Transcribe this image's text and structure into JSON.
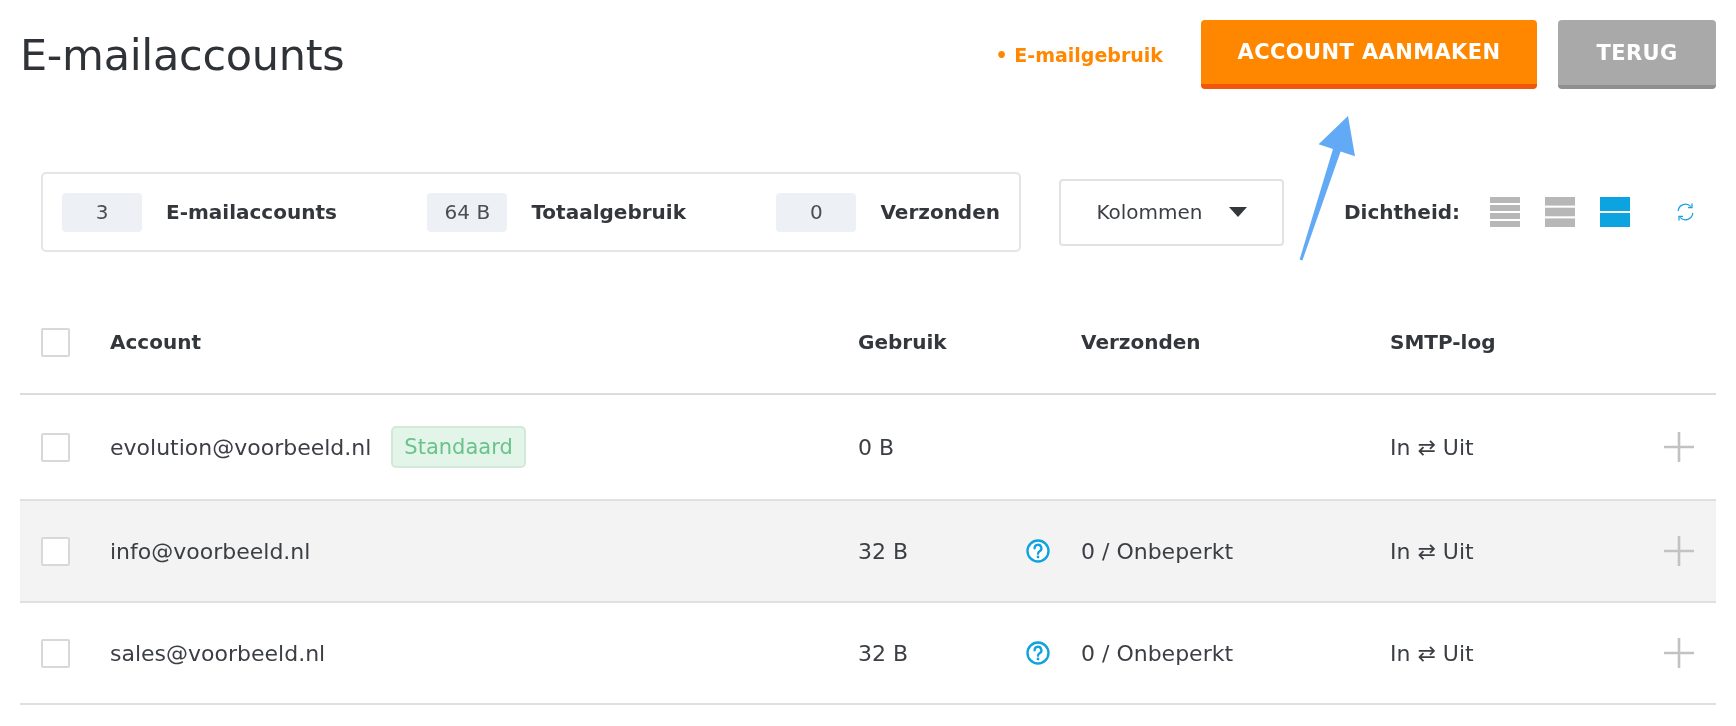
{
  "page": {
    "title": "E-mailaccounts"
  },
  "actions": {
    "link": "• E-mailgebruik",
    "buttons": [
      {
        "label": "ACCOUNT AANMAKEN",
        "kind": "primary"
      },
      {
        "label": "TERUG",
        "kind": "secondary"
      }
    ]
  },
  "summary": {
    "stats": [
      {
        "value": "3",
        "label": "E-mailaccounts"
      },
      {
        "value": "64 B",
        "label": "Totaalgebruik"
      },
      {
        "value": "0",
        "label": "Verzonden"
      }
    ]
  },
  "columns_menu": {
    "label": "Kolommen"
  },
  "density": {
    "label": "Dichtheid:",
    "options": [
      {
        "kind": "compact",
        "selected": false
      },
      {
        "kind": "medium",
        "selected": false
      },
      {
        "kind": "large",
        "selected": true
      }
    ]
  },
  "table": {
    "select_all": {
      "checked": false
    },
    "columns": [
      "Account",
      "Gebruik",
      "Verzonden",
      "SMTP-log"
    ],
    "rows": [
      {
        "checked": false,
        "hovered": false,
        "account": "evolution@voorbeeld.nl",
        "badge": "Standaard",
        "usage": "0 B",
        "help": false,
        "smtp_log": "In ⇄ Uit"
      },
      {
        "checked": false,
        "hovered": true,
        "account": "info@voorbeeld.nl",
        "usage": "32 B",
        "help": true,
        "sent": "0 / Onbeperkt",
        "smtp_log": "In ⇄ Uit"
      },
      {
        "checked": false,
        "hovered": false,
        "account": "sales@voorbeeld.nl",
        "usage": "32 B",
        "help": true,
        "sent": "0 / Onbeperkt",
        "smtp_log": "In ⇄ Uit"
      }
    ]
  }
}
